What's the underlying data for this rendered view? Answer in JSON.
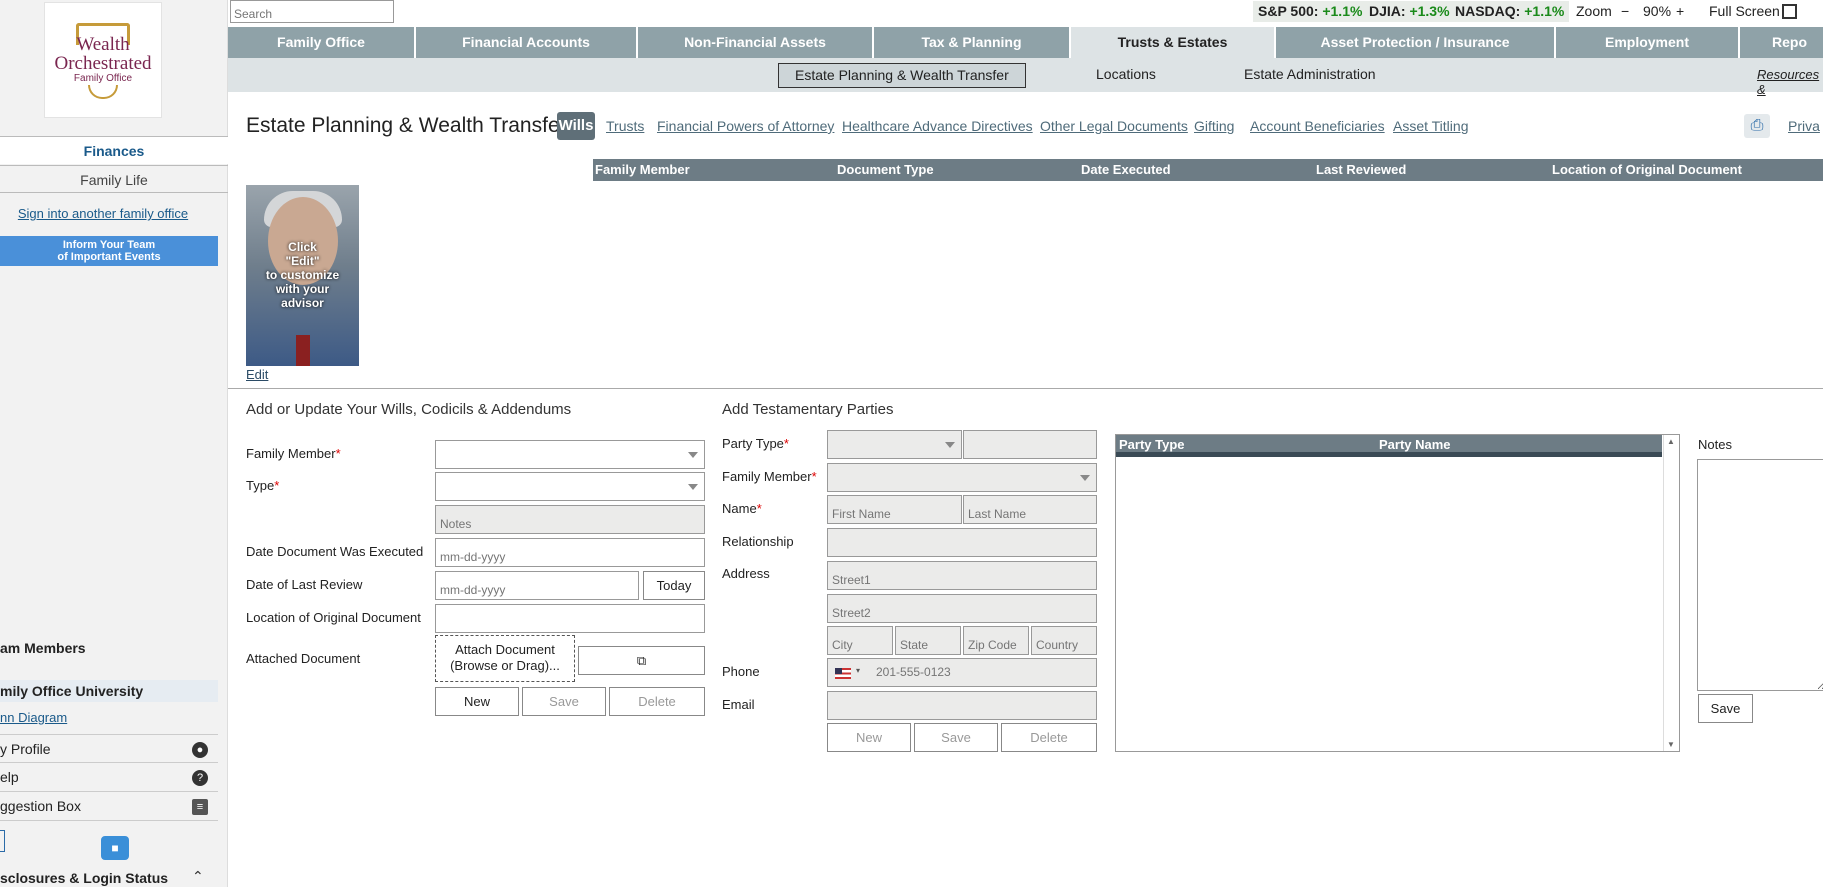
{
  "search": {
    "placeholder": "Search"
  },
  "tickers": [
    {
      "label": "S&P 500:",
      "value": "+1.1%"
    },
    {
      "label": "DJIA:",
      "value": "+1.3%"
    },
    {
      "label": "NASDAQ:",
      "value": "+1.1%"
    }
  ],
  "zoom": {
    "label": "Zoom",
    "minus": "−",
    "value": "90%",
    "plus": "+"
  },
  "fullscreen": {
    "label": "Full Screen"
  },
  "logo": {
    "line1": "Wealth",
    "line2": "Orchestrated",
    "line3": "Family Office"
  },
  "sidebar": {
    "tab_finances": "Finances",
    "tab_family_life": "Family Life",
    "sign_in_other": "Sign into another family office",
    "inform_line1": "Inform Your Team",
    "inform_line2": "of Important Events",
    "team_members": "am Members",
    "university": "mily Office University",
    "venn": "nn Diagram",
    "profile": "y Profile",
    "help": "elp",
    "suggestion": "ggestion Box",
    "disclosures": "sclosures & Login Status"
  },
  "mainnav": [
    "Family Office",
    "Financial Accounts",
    "Non-Financial Assets",
    "Tax & Planning",
    "Trusts & Estates",
    "Asset Protection / Insurance",
    "Employment",
    "Repo"
  ],
  "subnav": {
    "items": [
      "Estate Planning & Wealth Transfer",
      "Locations",
      "Estate Administration"
    ],
    "resources": "Resources &"
  },
  "page": {
    "title": "Estate Planning & Wealth Transfer",
    "active_pill": "Wills",
    "tabs": [
      "Trusts",
      "Financial Powers of Attorney",
      "Healthcare Advance Directives",
      "Other Legal Documents",
      "Gifting",
      "Account Beneficiaries",
      "Asset Titling"
    ],
    "privacy": "Priva"
  },
  "doc_grid": {
    "columns": [
      "Family Member",
      "Document Type",
      "Date Executed",
      "Last Reviewed",
      "Location of Original Document"
    ]
  },
  "photo": {
    "overlay_lines": [
      "Click",
      "\"Edit\"",
      "to customize",
      "with your",
      "advisor"
    ],
    "edit": "Edit"
  },
  "wills_form": {
    "title": "Add or Update Your Wills, Codicils & Addendums",
    "family_member_label": "Family Member",
    "type_label": "Type",
    "notes_placeholder": "Notes",
    "date_executed_label": "Date Document Was Executed",
    "date_placeholder": "mm-dd-yyyy",
    "last_review_label": "Date of Last Review",
    "today": "Today",
    "location_label": "Location of Original Document",
    "attached_label": "Attached Document",
    "attach_line1": "Attach Document",
    "attach_line2": "(Browse or Drag)...",
    "new": "New",
    "save": "Save",
    "delete": "Delete"
  },
  "party_form": {
    "title": "Add Testamentary Parties",
    "party_type_label": "Party Type",
    "family_member_label": "Family Member",
    "name_label": "Name",
    "first_name_placeholder": "First Name",
    "last_name_placeholder": "Last Name",
    "relationship_label": "Relationship",
    "address_label": "Address",
    "street1": "Street1",
    "street2": "Street2",
    "city": "City",
    "state": "State",
    "zip": "Zip Code",
    "country": "Country",
    "phone_label": "Phone",
    "phone_placeholder": "201-555-0123",
    "email_label": "Email",
    "new": "New",
    "save": "Save",
    "delete": "Delete"
  },
  "party_grid": {
    "columns": [
      "Party Type",
      "Party Name"
    ]
  },
  "notes": {
    "label": "Notes",
    "save": "Save"
  }
}
